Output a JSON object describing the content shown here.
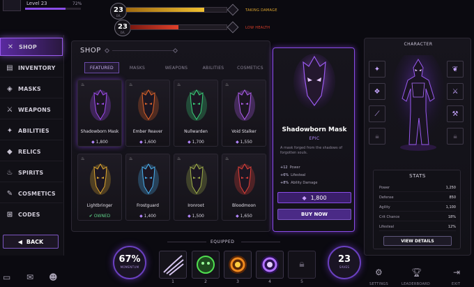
{
  "player": {
    "level_label": "Level 23",
    "xp_pct": "72%"
  },
  "hud": [
    {
      "level": "23",
      "sub": "LVL",
      "status": "TAKING DAMAGE",
      "bar_fill": 0.78,
      "bar_color": "#e0a020"
    },
    {
      "level": "23",
      "sub": "LVL",
      "status": "LOW HEALTH",
      "bar_fill": 0.5,
      "bar_color": "#c8301e"
    }
  ],
  "sidebar": {
    "items": [
      {
        "label": "SHOP",
        "icon": "crossed-swords-icon",
        "glyph": "✕"
      },
      {
        "label": "INVENTORY",
        "icon": "chest-icon",
        "glyph": "▤"
      },
      {
        "label": "MASKS",
        "icon": "mask-icon",
        "glyph": "◈"
      },
      {
        "label": "WEAPONS",
        "icon": "sword-icon",
        "glyph": "⚔"
      },
      {
        "label": "ABILITIES",
        "icon": "ability-icon",
        "glyph": "✦"
      },
      {
        "label": "RELICS",
        "icon": "relic-icon",
        "glyph": "◆"
      },
      {
        "label": "SPIRITS",
        "icon": "flame-icon",
        "glyph": "♨"
      },
      {
        "label": "COSMETICS",
        "icon": "paint-icon",
        "glyph": "✎"
      },
      {
        "label": "CODES",
        "icon": "code-icon",
        "glyph": "⊞"
      }
    ],
    "back_label": "BACK"
  },
  "shop": {
    "title": "SHOP",
    "tabs": [
      "FEATURED",
      "MASKS",
      "WEAPONS",
      "ABILITIES",
      "COSMETICS"
    ],
    "items": [
      {
        "name": "Shadowborn Mask",
        "price": "1,800",
        "color": "#a04df0"
      },
      {
        "name": "Ember Reaver",
        "price": "1,600",
        "color": "#e0642a"
      },
      {
        "name": "Nullwarden",
        "price": "1,700",
        "color": "#3ad07a"
      },
      {
        "name": "Void Stalker",
        "price": "1,550",
        "color": "#b05ef0"
      },
      {
        "name": "Lightbringer",
        "price": "OWNED",
        "color": "#e0a830"
      },
      {
        "name": "Frostguard",
        "price": "1,400",
        "color": "#4ab0f0"
      },
      {
        "name": "Ironroot",
        "price": "1,500",
        "color": "#a0b04a"
      },
      {
        "name": "Bloodmoon",
        "price": "1,650",
        "color": "#e0403a"
      }
    ]
  },
  "detail": {
    "name": "Shadowborn Mask",
    "rarity": "EPIC",
    "description": "A mask forged from the shadows of forgotten souls.",
    "stats": [
      {
        "value": "+12",
        "label": "Power"
      },
      {
        "value": "+6%",
        "label": "Lifesteal"
      },
      {
        "value": "+8%",
        "label": "Ability Damage"
      }
    ],
    "price": "1,800",
    "buy_label": "BUY NOW"
  },
  "character": {
    "title": "CHARACTER",
    "stats_title": "STATS",
    "stats": [
      {
        "label": "Power",
        "value": "1,250"
      },
      {
        "label": "Defense",
        "value": "850"
      },
      {
        "label": "Agility",
        "value": "1,100"
      },
      {
        "label": "Crit Chance",
        "value": "18%"
      },
      {
        "label": "Lifesteal",
        "value": "12%"
      }
    ],
    "view_label": "VIEW DETAILS"
  },
  "bottom": {
    "equipped_label": "EQUIPPED",
    "momentum": {
      "value": "67%",
      "label": "MOMENTUM"
    },
    "saves": {
      "value": "23",
      "label": "SAVES"
    },
    "slots": [
      "1",
      "2",
      "3",
      "4",
      "5"
    ],
    "actions": [
      {
        "label": "SETTINGS",
        "icon": "gear-icon"
      },
      {
        "label": "LEADERBOARD",
        "icon": "trophy-icon"
      },
      {
        "label": "EXIT",
        "icon": "exit-icon"
      }
    ]
  }
}
